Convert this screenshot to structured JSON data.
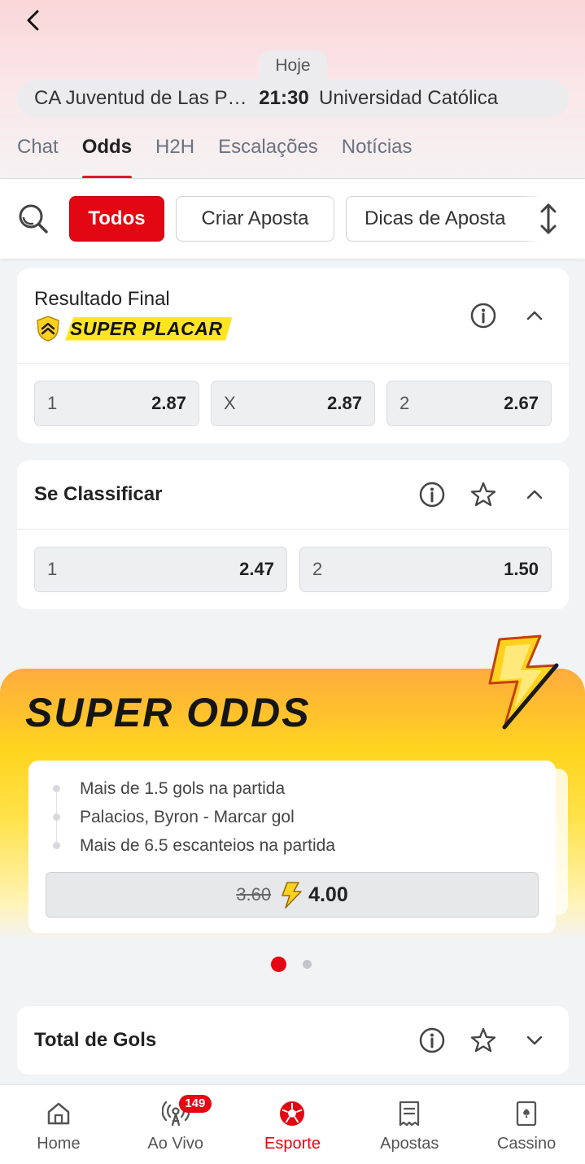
{
  "header": {
    "date_label": "Hoje",
    "home_team": "CA Juventud de Las Piedras",
    "time": "21:30",
    "away_team": "Universidad Católica"
  },
  "tabs": [
    {
      "label": "Chat",
      "active": false
    },
    {
      "label": "Odds",
      "active": true
    },
    {
      "label": "H2H",
      "active": false
    },
    {
      "label": "Escalações",
      "active": false
    },
    {
      "label": "Notícias",
      "active": false
    }
  ],
  "filters": {
    "todos": "Todos",
    "criar_aposta": "Criar Aposta",
    "dicas_aposta": "Dicas de Aposta"
  },
  "markets": {
    "resultado_final": {
      "title": "Resultado Final",
      "badge": "SUPER PLACAR",
      "odds": [
        {
          "label": "1",
          "value": "2.87"
        },
        {
          "label": "X",
          "value": "2.87"
        },
        {
          "label": "2",
          "value": "2.67"
        }
      ]
    },
    "se_classificar": {
      "title": "Se Classificar",
      "odds": [
        {
          "label": "1",
          "value": "2.47"
        },
        {
          "label": "2",
          "value": "1.50"
        }
      ]
    },
    "total_gols": {
      "title": "Total de Gols"
    }
  },
  "super_odds": {
    "title": "SUPER ODDS",
    "selections": [
      "Mais de 1.5 gols na partida",
      "Palacios, Byron - Marcar gol",
      "Mais de 6.5 escanteios na partida"
    ],
    "old_odd": "3.60",
    "new_odd": "4.00",
    "pages": 2,
    "current_page": 1
  },
  "bottom_nav": {
    "items": [
      {
        "label": "Home",
        "icon": "home-icon"
      },
      {
        "label": "Ao Vivo",
        "icon": "live-icon",
        "badge": "149"
      },
      {
        "label": "Esporte",
        "icon": "soccer-ball-icon",
        "active": true
      },
      {
        "label": "Apostas",
        "icon": "receipt-icon"
      },
      {
        "label": "Cassino",
        "icon": "cards-icon"
      }
    ]
  },
  "colors": {
    "accent": "#e30613",
    "highlight_yellow": "#ffe51f",
    "promo_orange": "#ffab3e"
  }
}
